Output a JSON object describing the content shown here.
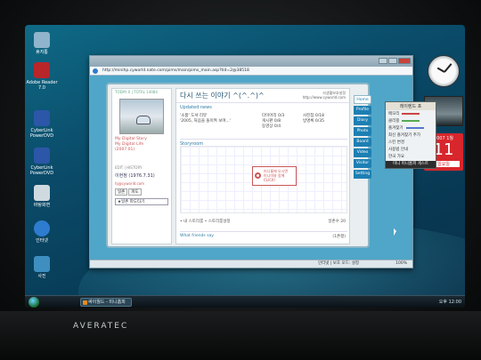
{
  "desktop": {
    "icons": [
      {
        "label": "휴지통",
        "color": "#8fb4cc",
        "icon": "recycle-bin-icon"
      },
      {
        "label": "Adobe Reader 7.0",
        "color": "#b8262a",
        "icon": "adobe-reader-icon"
      },
      {
        "label": "CyberLink PowerDVD",
        "color": "#2c56a8",
        "icon": "powerdvd-icon"
      },
      {
        "label": "CyberLink PowerDVD",
        "color": "#2c56a8",
        "icon": "powerdvd-icon"
      },
      {
        "label": "바탕화면",
        "color": "#cfd9e0",
        "icon": "desktop-shortcut-icon"
      },
      {
        "label": "인터넷",
        "color": "#2e7ccf",
        "icon": "internet-explorer-icon"
      },
      {
        "label": "사진",
        "color": "#3e8ec0",
        "icon": "photo-icon"
      }
    ]
  },
  "gadgets": {
    "calendar_month": "2007 1월",
    "calendar_day": "11",
    "calendar_weekday": "일요일"
  },
  "side_panel": {
    "title": "레이렌드 포",
    "rows": [
      "메모리",
      "클리핑",
      "즐겨찾기",
      "최신 즐겨찾기 추가",
      "스킨 변경",
      "사용법 안내",
      "한국 가요"
    ],
    "bottom": "미니 미니홈피 게스트"
  },
  "taskbar": {
    "task_label": "싸이월드 - 미니홈피",
    "tray_text": "오후 12:00"
  },
  "browser": {
    "url": "http://minihp.cyworld.nate.com/pims/main/pims_main.asp?tid=2@38518",
    "status_zone": "인터넷 | 보호 모드: 설정",
    "zoom": "100%"
  },
  "minihompy": {
    "today": "TODAY 0 | TOTAL 14084",
    "history": "My Digital Story\nMy Digital Life\n(2007.01)",
    "edit": "EDIT | HISTORY",
    "name": "이현정 (1976.7.31)",
    "email": "hj@cyworld.com",
    "buttons": [
      "일촌",
      "파도"
    ],
    "wave": "★일촌 파도타기",
    "page_title": "다시 쓰는 이야기 ^(^.^)^",
    "site_line1": "사생활보호설정",
    "site_line2": "http://www.cyworld.com",
    "updated_label": "Updated news",
    "updated_items": [
      "'소품' 도서 리뷰",
      "'2005, 처음을 돌이켜 보며...'"
    ],
    "menu_items": [
      "다이어리 0/3",
      "사진첩 0/18",
      "게시판 0/8",
      "방명록 0/35",
      "동영상 0/4"
    ],
    "storyroom_label": "Storyroom",
    "popup_text": "미니룸에 오시면\n 미니미와 함께\nCLICK!",
    "foot1_left": "• 내 스토리룸 • 스토리룸설정",
    "foot1_right": "일촌수 20",
    "foot2_left": "What friends say",
    "foot2_right": "(1촌평)",
    "tabs": [
      "Home",
      "Profile",
      "Diary",
      "Photo",
      "Board",
      "Video",
      "Visitor",
      "Setting"
    ]
  },
  "hardware": {
    "brand": "AVERATEC"
  }
}
